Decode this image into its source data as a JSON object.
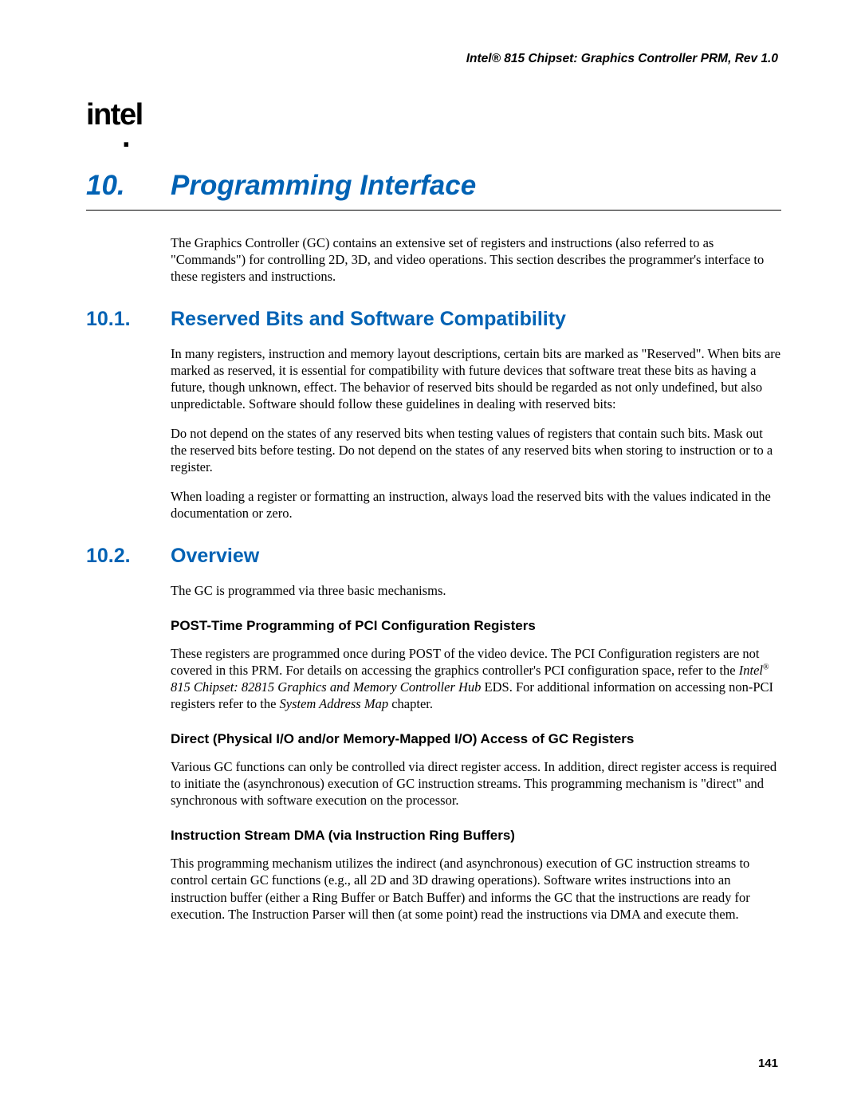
{
  "header": {
    "doc_title": "Intel® 815 Chipset: Graphics Controller PRM, Rev 1.0",
    "logo_text": "intel"
  },
  "chapter": {
    "number": "10.",
    "title": "Programming Interface"
  },
  "intro_para": "The Graphics Controller (GC) contains an extensive set of registers and instructions (also referred to as \"Commands\") for controlling 2D, 3D, and video operations. This section describes the programmer's interface to these registers and instructions.",
  "section_10_1": {
    "number": "10.1.",
    "title": "Reserved Bits and Software Compatibility",
    "para1": "In many registers, instruction and memory layout descriptions, certain bits are marked as \"Reserved\". When bits are marked as reserved, it is essential for compatibility with future devices that software treat these bits as having a future, though unknown, effect. The behavior of reserved bits should be regarded as not only undefined, but also unpredictable. Software should follow these guidelines in dealing with reserved bits:",
    "para2": "Do not depend on the states of any reserved bits when testing values of registers that contain such bits. Mask out the reserved bits before testing. Do not depend on the states of any reserved bits when storing to instruction or to a register.",
    "para3": "When loading a register or formatting an instruction, always load the reserved bits with the values indicated in the documentation or zero."
  },
  "section_10_2": {
    "number": "10.2.",
    "title": "Overview",
    "para1": "The GC is programmed via three basic mechanisms.",
    "sub1": {
      "title": "POST-Time Programming of PCI Configuration Registers",
      "para_pre": "These registers are programmed once during POST of the video device. The PCI Configuration registers are not covered in this PRM. For details on accessing the graphics controller's PCI configuration space, refer to the ",
      "para_ital1": "Intel",
      "para_sup": "®",
      "para_ital2": " 815 Chipset: 82815 Graphics and Memory Controller Hub",
      "para_mid": " EDS. For additional information on accessing non-PCI registers refer to the ",
      "para_ital3": "System Address Map",
      "para_end": " chapter."
    },
    "sub2": {
      "title": "Direct (Physical I/O and/or Memory-Mapped I/O) Access of GC Registers",
      "para": "Various GC functions can only be controlled via direct register access. In addition, direct register access is required to initiate the (asynchronous) execution of GC instruction streams. This programming mechanism is \"direct\" and synchronous with software execution on the processor."
    },
    "sub3": {
      "title": "Instruction Stream DMA (via Instruction Ring Buffers)",
      "para": "This programming mechanism utilizes the indirect (and asynchronous) execution of GC instruction streams to control certain GC functions (e.g., all 2D and 3D drawing operations). Software writes instructions into an instruction buffer (either a Ring Buffer or Batch Buffer) and informs the GC that the instructions are ready for execution. The Instruction Parser will then (at some point) read the instructions via DMA and execute them."
    }
  },
  "page_number": "141"
}
